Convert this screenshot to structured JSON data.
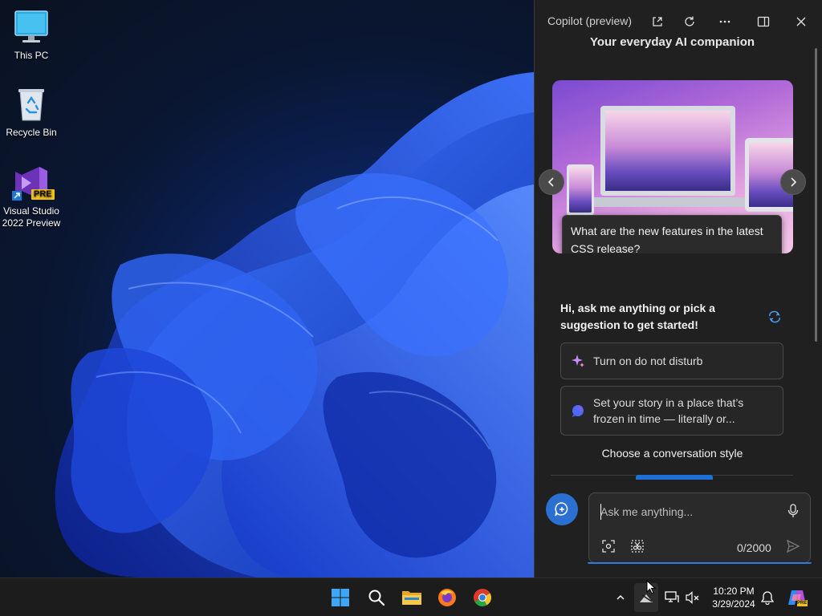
{
  "desktop": {
    "icons": [
      {
        "label": "This PC",
        "icon": "monitor-icon"
      },
      {
        "label": "Recycle Bin",
        "icon": "recycle-bin-icon"
      },
      {
        "label_line1": "Visual Studio",
        "label_line2": "2022 Preview",
        "badge": "PRE",
        "icon": "visual-studio-icon"
      }
    ]
  },
  "copilot": {
    "title": "Copilot (preview)",
    "tagline": "Your everyday AI companion",
    "carousel": {
      "prompt": "What are the new features in the latest CSS release?"
    },
    "intro": "Hi, ask me anything or pick a suggestion to get started!",
    "suggestions": [
      {
        "text": "Turn on do not disturb",
        "icon": "sparkle-icon"
      },
      {
        "text": "Set your story in a place that’s frozen in time — literally or...",
        "icon": "chat-bubble-icon"
      }
    ],
    "style_title": "Choose a conversation style",
    "input": {
      "placeholder": "Ask me anything...",
      "counter": "0/2000"
    }
  },
  "taskbar": {
    "apps": [
      "start-icon",
      "search-icon",
      "file-explorer-icon",
      "firefox-icon",
      "chrome-icon"
    ],
    "time": "10:20 PM",
    "date": "3/29/2024"
  },
  "colors": {
    "accent": "#2b6fd0",
    "panel_bg": "#202020",
    "taskbar_bg": "#1c1c1c",
    "wallpaper_blue": "#1f4fe0"
  }
}
